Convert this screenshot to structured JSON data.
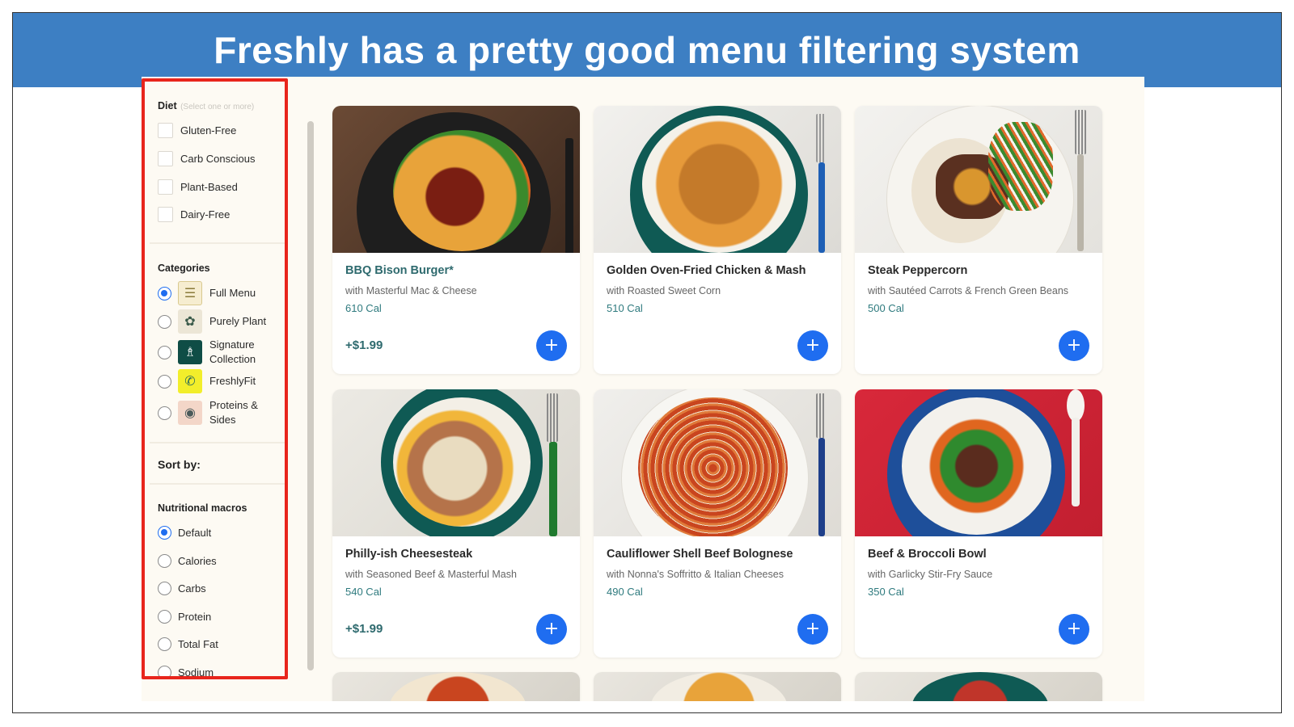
{
  "banner": {
    "title": "Freshly has a pretty good menu filtering system"
  },
  "sidebar": {
    "diet": {
      "title": "Diet",
      "hint": "(Select one or more)",
      "options": [
        "Gluten-Free",
        "Carb Conscious",
        "Plant-Based",
        "Dairy-Free"
      ]
    },
    "categories": {
      "title": "Categories",
      "items": [
        {
          "label": "Full Menu",
          "selected": true,
          "icon": "menu-list-icon"
        },
        {
          "label": "Purely Plant",
          "selected": false,
          "icon": "leaf-icon"
        },
        {
          "label": "Signature Collection",
          "selected": false,
          "icon": "chef-hat-icon"
        },
        {
          "label": "FreshlyFit",
          "selected": false,
          "icon": "fitness-icon"
        },
        {
          "label": "Proteins & Sides",
          "selected": false,
          "icon": "protein-icon"
        }
      ]
    },
    "sort": {
      "title": "Sort by:"
    },
    "macros": {
      "title": "Nutritional macros",
      "options": [
        {
          "label": "Default",
          "selected": true
        },
        {
          "label": "Calories",
          "selected": false
        },
        {
          "label": "Carbs",
          "selected": false
        },
        {
          "label": "Protein",
          "selected": false
        },
        {
          "label": "Total Fat",
          "selected": false
        },
        {
          "label": "Sodium",
          "selected": false
        }
      ]
    }
  },
  "menu": {
    "add_symbol": "+",
    "cards": [
      {
        "title": "BBQ Bison Burger*",
        "subtitle": "with Masterful Mac & Cheese",
        "calories": "610 Cal",
        "price": "+$1.99"
      },
      {
        "title": "Golden Oven-Fried Chicken & Mash",
        "subtitle": "with Roasted Sweet Corn",
        "calories": "510 Cal",
        "price": ""
      },
      {
        "title": "Steak Peppercorn",
        "subtitle": "with Sautéed Carrots & French Green Beans",
        "calories": "500 Cal",
        "price": ""
      },
      {
        "title": "Philly-ish Cheesesteak",
        "subtitle": "with Seasoned Beef & Masterful Mash",
        "calories": "540 Cal",
        "price": "+$1.99"
      },
      {
        "title": "Cauliflower Shell Beef Bolognese",
        "subtitle": "with Nonna's Soffritto & Italian Cheeses",
        "calories": "490 Cal",
        "price": ""
      },
      {
        "title": "Beef & Broccoli Bowl",
        "subtitle": "with Garlicky Stir-Fry Sauce",
        "calories": "350 Cal",
        "price": ""
      }
    ]
  },
  "colors": {
    "banner": "#3d7fc3",
    "accent": "#1f6df0",
    "highlight": "#e8251c",
    "teal": "#2e6a6e"
  }
}
